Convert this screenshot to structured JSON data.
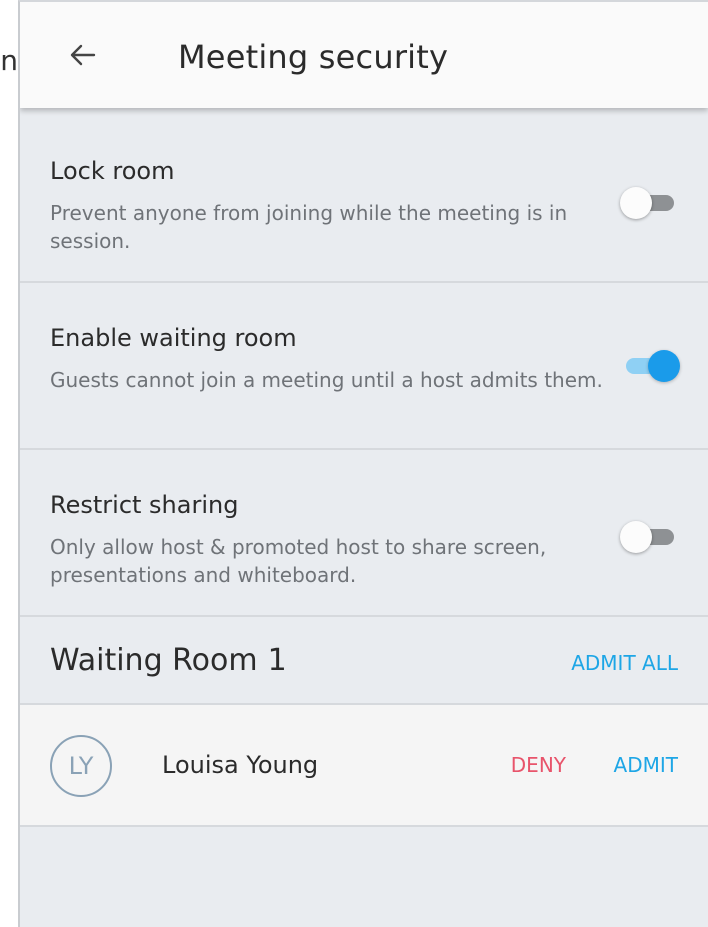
{
  "outer_text": "n",
  "header": {
    "back_icon": "arrow-left-icon",
    "title": "Meeting security"
  },
  "settings": [
    {
      "title": "Lock room",
      "description": "Prevent anyone from joining while the meeting is in session.",
      "enabled": false
    },
    {
      "title": "Enable waiting room",
      "description": "Guests cannot join a meeting until a host admits them.",
      "enabled": true
    },
    {
      "title": "Restrict sharing",
      "description": "Only allow host & promoted host to share screen, presentations and whiteboard.",
      "enabled": false
    }
  ],
  "waiting_room": {
    "title": "Waiting Room",
    "count": "1",
    "admit_all_label": "ADMIT ALL",
    "guests": [
      {
        "initials": "LY",
        "name": "Louisa Young",
        "deny_label": "DENY",
        "admit_label": "ADMIT"
      }
    ]
  },
  "colors": {
    "accent": "#1ea6e6",
    "toggle_on": "#1a9bea",
    "deny": "#e8546b",
    "background": "#e9ecf0",
    "avatar": "#8aa2b6"
  }
}
